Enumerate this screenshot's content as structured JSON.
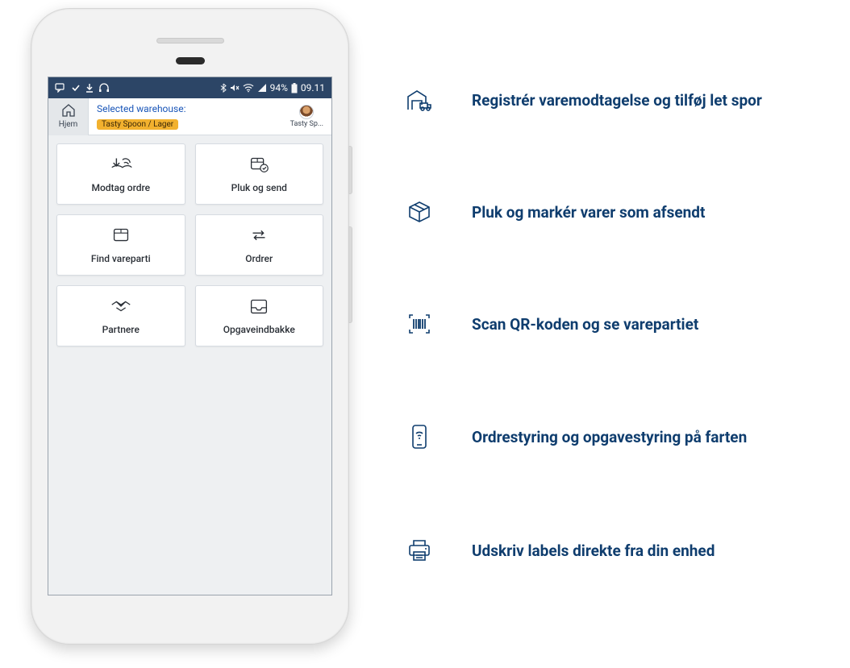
{
  "status_bar": {
    "battery_pct": "94%",
    "time": "09.11"
  },
  "header": {
    "home_label": "Hjem",
    "selected_label": "Selected warehouse:",
    "warehouse_pill": "Tasty Spoon / Lager",
    "user_short": "Tasty Sp..."
  },
  "cards": [
    {
      "label": "Modtag ordre"
    },
    {
      "label": "Pluk og send"
    },
    {
      "label": "Find vareparti"
    },
    {
      "label": "Ordrer"
    },
    {
      "label": "Partnere"
    },
    {
      "label": "Opgaveindbakke"
    }
  ],
  "features": [
    {
      "text": "Registrér varemodtagelse og tilføj let spor"
    },
    {
      "text": "Pluk og markér varer som afsendt"
    },
    {
      "text": "Scan QR-koden og se varepartiet"
    },
    {
      "text": "Ordrestyring og opgavestyring på farten"
    },
    {
      "text": "Udskriv labels direkte fra din enhed"
    }
  ]
}
